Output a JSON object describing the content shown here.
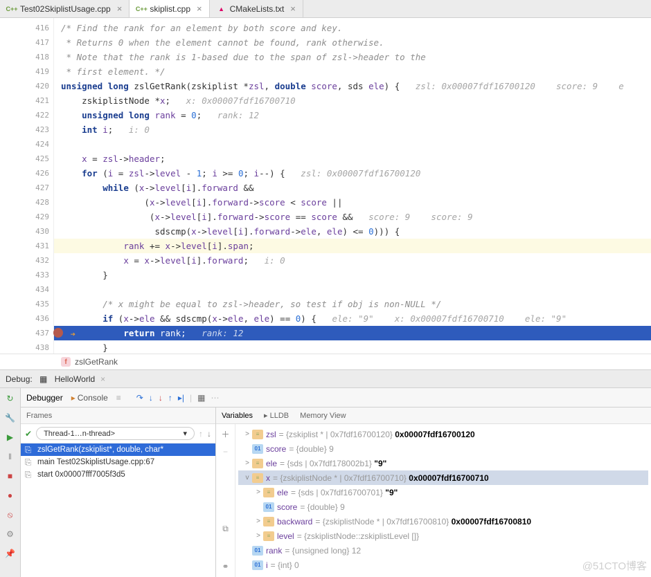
{
  "tabs": [
    {
      "icon": "C++",
      "label": "Test02SkiplistUsage.cpp",
      "active": false
    },
    {
      "icon": "C++",
      "label": "skiplist.cpp",
      "active": true
    },
    {
      "icon": "▲",
      "label": "CMakeLists.txt",
      "active": false
    }
  ],
  "lines": {
    "start": 416,
    "rows": [
      {
        "n": 416,
        "html": "<span class='c'>/* Find the rank for an element by both score and key.</span>"
      },
      {
        "n": 417,
        "html": "<span class='c'> * Returns 0 when the element cannot be found, rank otherwise.</span>"
      },
      {
        "n": 418,
        "html": "<span class='c'> * Note that the rank is 1-based due to the span of zsl-&gt;header to the</span>"
      },
      {
        "n": 419,
        "html": "<span class='c'> * first element. */</span>"
      },
      {
        "n": 420,
        "html": "<span class='k'>unsigned long</span> <span style='color:#333'>zslGetRank</span>(zskiplist *<span class='var'>zsl</span>, <span class='k'>double</span> <span class='var'>score</span>, sds <span class='var'>ele</span>) {   <span class='hint'>zsl: 0x00007fdf16700120    score: 9    e</span>"
      },
      {
        "n": 421,
        "html": "    zskiplistNode *<span class='var'>x</span>;   <span class='hint'>x: 0x00007fdf16700710</span>"
      },
      {
        "n": 422,
        "html": "    <span class='k'>unsigned long</span> <span class='var'>rank</span> = <span class='n'>0</span>;   <span class='hint'>rank: 12</span>"
      },
      {
        "n": 423,
        "html": "    <span class='k'>int</span> <span class='var'>i</span>;   <span class='hint'>i: 0</span>"
      },
      {
        "n": 424,
        "html": ""
      },
      {
        "n": 425,
        "html": "    <span class='var'>x</span> = <span class='var'>zsl</span>-&gt;<span class='var'>header</span>;"
      },
      {
        "n": 426,
        "html": "    <span class='k'>for</span> (<span class='var'>i</span> = <span class='var'>zsl</span>-&gt;<span class='var'>level</span> - <span class='n'>1</span>; <span class='var'>i</span> &gt;= <span class='n'>0</span>; <span class='var'>i</span>--) {   <span class='hint'>zsl: 0x00007fdf16700120</span>"
      },
      {
        "n": 427,
        "html": "        <span class='k'>while</span> (<span class='var'>x</span>-&gt;<span class='var'>level</span>[<span class='var'>i</span>].<span class='var'>forward</span> &amp;&amp;"
      },
      {
        "n": 428,
        "html": "                (<span class='var'>x</span>-&gt;<span class='var'>level</span>[<span class='var'>i</span>].<span class='var'>forward</span>-&gt;<span class='var'>score</span> &lt; <span class='var'>score</span> ||"
      },
      {
        "n": 429,
        "html": "                 (<span class='var'>x</span>-&gt;<span class='var'>level</span>[<span class='var'>i</span>].<span class='var'>forward</span>-&gt;<span class='var'>score</span> == <span class='var'>score</span> &amp;&amp;   <span class='hint'>score: 9    score: 9</span>"
      },
      {
        "n": 430,
        "html": "                  sdscmp(<span class='var'>x</span>-&gt;<span class='var'>level</span>[<span class='var'>i</span>].<span class='var'>forward</span>-&gt;<span class='var'>ele</span>, <span class='var'>ele</span>) &lt;= <span class='n'>0</span>))) {"
      },
      {
        "n": 431,
        "hl": true,
        "html": "            <span class='var'>rank</span> += <span class='var'>x</span>-&gt;<span class='var'>level</span>[<span class='var'>i</span>].<span class='var'>span</span>;"
      },
      {
        "n": 432,
        "html": "            <span class='var'>x</span> = <span class='var'>x</span>-&gt;<span class='var'>level</span>[<span class='var'>i</span>].<span class='var'>forward</span>;   <span class='hint'>i: 0</span>"
      },
      {
        "n": 433,
        "html": "        }"
      },
      {
        "n": 434,
        "html": ""
      },
      {
        "n": 435,
        "html": "        <span class='c'>/* x might be equal to zsl-&gt;header, so test if obj is non-NULL */</span>"
      },
      {
        "n": 436,
        "html": "        <span class='k'>if</span> (<span class='var'>x</span>-&gt;<span class='var'>ele</span> &amp;&amp; sdscmp(<span class='var'>x</span>-&gt;<span class='var'>ele</span>, <span class='var'>ele</span>) == <span class='n'>0</span>) {   <span class='hint'>ele: \"9\"    x: 0x00007fdf16700710    ele: \"9\"</span>"
      },
      {
        "n": 437,
        "exec": true,
        "bp": true,
        "html": "            <span class='k'>return</span> <span class='var'>rank</span>;   <span class='hint'>rank: 12</span>"
      },
      {
        "n": 438,
        "html": "        }"
      }
    ]
  },
  "breadcrumb": {
    "fn": "zslGetRank"
  },
  "debug": {
    "label": "Debug:",
    "config": "HelloWorld",
    "tabs": [
      "Debugger",
      "Console"
    ],
    "frames_label": "Frames",
    "thread": "Thread-1…n-thread>",
    "frames": [
      {
        "label": "zslGetRank(zskiplist*, double, char*",
        "sel": true
      },
      {
        "label": "main Test02SkiplistUsage.cpp:67"
      },
      {
        "label": "start 0x00007fff7005f3d5"
      }
    ],
    "var_tabs": [
      "Variables",
      "LLDB",
      "Memory View"
    ],
    "vars": [
      {
        "tw": ">",
        "ind": 0,
        "b": "≡",
        "bc": "bO",
        "n": "zsl",
        "v": "= {zskiplist * | 0x7fdf16700120} ",
        "bold": "0x00007fdf16700120"
      },
      {
        "tw": "",
        "ind": 0,
        "b": "01",
        "bc": "b01",
        "n": "score",
        "v": "= {double} 9"
      },
      {
        "tw": ">",
        "ind": 0,
        "b": "≡",
        "bc": "bO",
        "n": "ele",
        "v": "= {sds | 0x7fdf178002b1} ",
        "bold": "\"9\""
      },
      {
        "tw": "v",
        "ind": 0,
        "b": "≡",
        "bc": "bO",
        "n": "x",
        "v": "= {zskiplistNode * | 0x7fdf16700710} ",
        "bold": "0x00007fdf16700710",
        "sel": true
      },
      {
        "tw": ">",
        "ind": 1,
        "b": "≡",
        "bc": "bO",
        "n": "ele",
        "v": "= {sds | 0x7fdf16700701} ",
        "bold": "\"9\""
      },
      {
        "tw": "",
        "ind": 1,
        "b": "01",
        "bc": "b01",
        "n": "score",
        "v": "= {double} 9"
      },
      {
        "tw": ">",
        "ind": 1,
        "b": "≡",
        "bc": "bO",
        "n": "backward",
        "v": "= {zskiplistNode * | 0x7fdf16700810} ",
        "bold": "0x00007fdf16700810"
      },
      {
        "tw": ">",
        "ind": 1,
        "b": "≡",
        "bc": "bO",
        "n": "level",
        "v": "= {zskiplistNode::zskiplistLevel []}"
      },
      {
        "tw": "",
        "ind": 0,
        "b": "01",
        "bc": "b01",
        "n": "rank",
        "v": "= {unsigned long} 12"
      },
      {
        "tw": "",
        "ind": 0,
        "b": "01",
        "bc": "b01",
        "n": "i",
        "v": "= {int} 0"
      }
    ]
  },
  "watermark": "@51CTO博客"
}
